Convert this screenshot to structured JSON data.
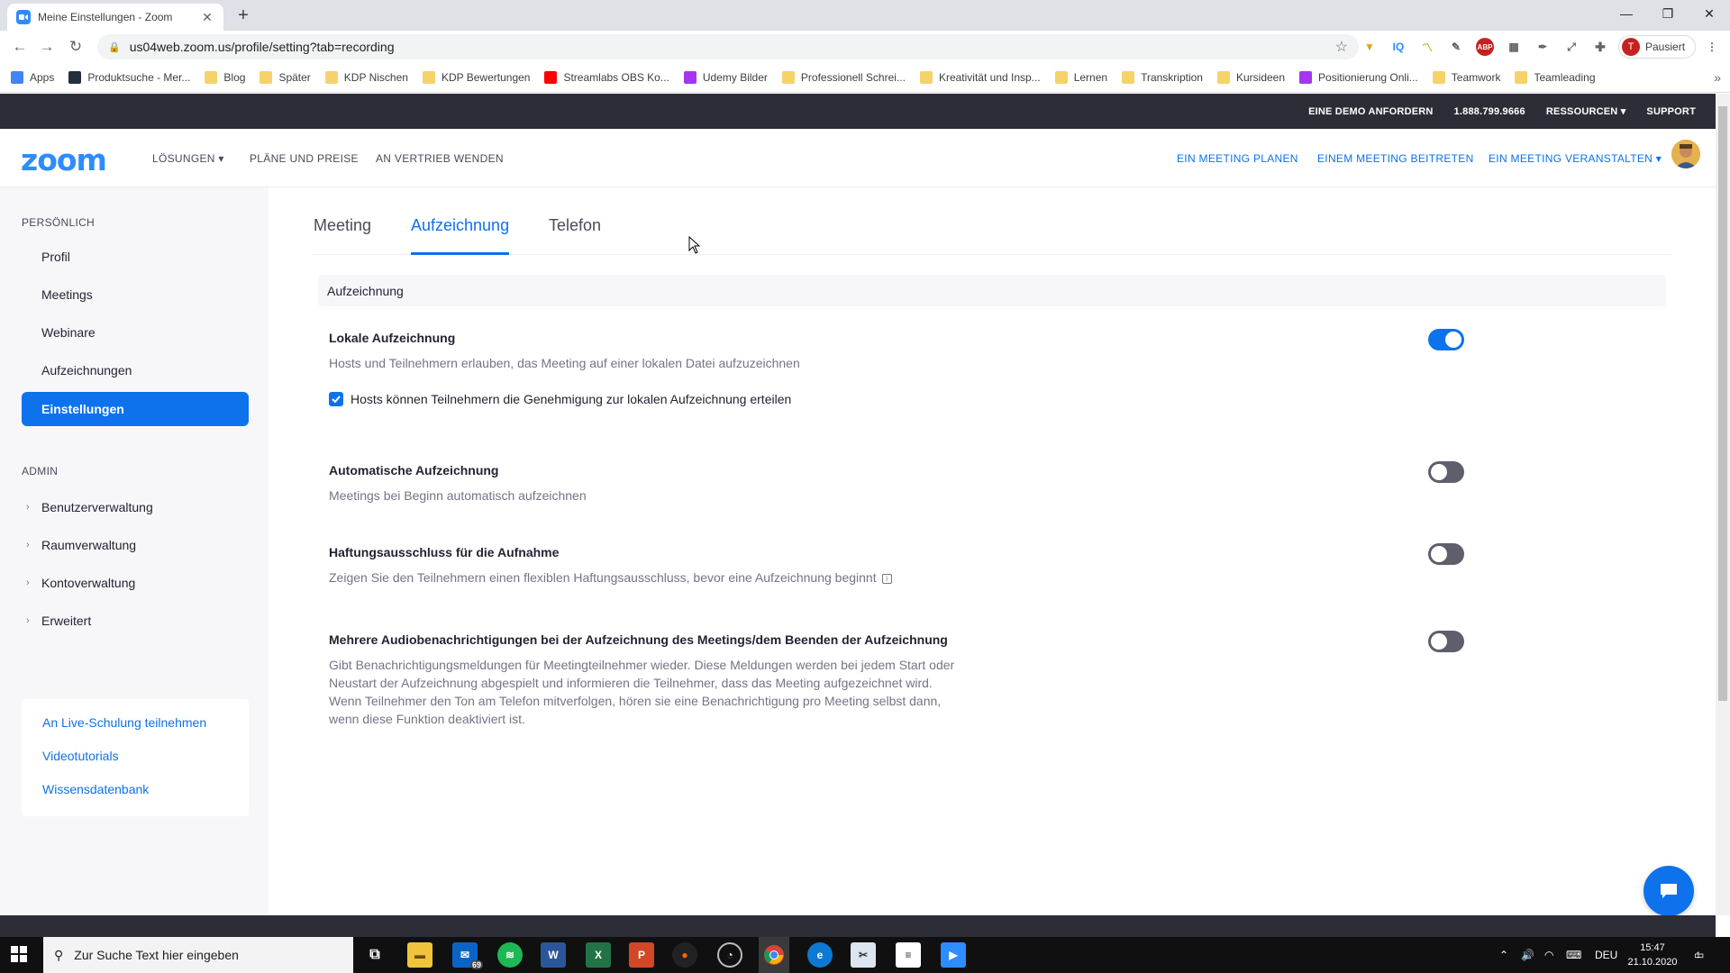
{
  "browser": {
    "tab_title": "Meine Einstellungen - Zoom",
    "new_tab": "+",
    "url": "us04web.zoom.us/profile/setting?tab=recording",
    "profile_initial": "T",
    "profile_status": "Pausiert",
    "ext_iq": "IQ",
    "ext_abp": "ABP"
  },
  "bookmarks": [
    {
      "label": "Apps",
      "icon": "apps-grid-icon"
    },
    {
      "label": "Produktsuche - Mer...",
      "icon": "merch-icon"
    },
    {
      "label": "Blog",
      "icon": "folder-icon"
    },
    {
      "label": "Später",
      "icon": "folder-icon"
    },
    {
      "label": "KDP Nischen",
      "icon": "folder-icon"
    },
    {
      "label": "KDP Bewertungen",
      "icon": "folder-icon"
    },
    {
      "label": "Streamlabs OBS Ko...",
      "icon": "youtube-icon"
    },
    {
      "label": "Udemy Bilder",
      "icon": "udemy-icon"
    },
    {
      "label": "Professionell Schrei...",
      "icon": "folder-icon"
    },
    {
      "label": "Kreativität und Insp...",
      "icon": "folder-icon"
    },
    {
      "label": "Lernen",
      "icon": "folder-icon"
    },
    {
      "label": "Transkription",
      "icon": "folder-icon"
    },
    {
      "label": "Kursideen",
      "icon": "folder-icon"
    },
    {
      "label": "Positionierung Onli...",
      "icon": "udemy-icon"
    },
    {
      "label": "Teamwork",
      "icon": "folder-icon"
    },
    {
      "label": "Teamleading",
      "icon": "folder-icon"
    }
  ],
  "zoom_top": {
    "demo": "EINE DEMO ANFORDERN",
    "phone": "1.888.799.9666",
    "resources": "RESSOURCEN",
    "support": "SUPPORT"
  },
  "zoom_nav": {
    "logo": "zoom",
    "solutions": "LÖSUNGEN",
    "plans": "PLÄNE UND PREISE",
    "sales": "AN VERTRIEB WENDEN",
    "schedule": "EIN MEETING PLANEN",
    "join": "EINEM MEETING BEITRETEN",
    "host": "EIN MEETING VERANSTALTEN"
  },
  "sidebar": {
    "personal_label": "PERSÖNLICH",
    "personal_items": [
      "Profil",
      "Meetings",
      "Webinare",
      "Aufzeichnungen",
      "Einstellungen"
    ],
    "admin_label": "ADMIN",
    "admin_items": [
      "Benutzerverwaltung",
      "Raumverwaltung",
      "Kontoverwaltung",
      "Erweitert"
    ],
    "help_links": [
      "An Live-Schulung teilnehmen",
      "Videotutorials",
      "Wissensdatenbank"
    ]
  },
  "main": {
    "tabs": [
      "Meeting",
      "Aufzeichnung",
      "Telefon"
    ],
    "section_title": "Aufzeichnung",
    "settings": [
      {
        "title": "Lokale Aufzeichnung",
        "desc": "Hosts und Teilnehmern erlauben, das Meeting auf einer lokalen Datei aufzuzeichnen",
        "enabled": true,
        "checkbox_label": "Hosts können Teilnehmern die Genehmigung zur lokalen Aufzeichnung erteilen",
        "checkbox_checked": true
      },
      {
        "title": "Automatische Aufzeichnung",
        "desc": "Meetings bei Beginn automatisch aufzeichnen",
        "enabled": false
      },
      {
        "title": "Haftungsausschluss für die Aufnahme",
        "desc": "Zeigen Sie den Teilnehmern einen flexiblen Haftungsausschluss, bevor eine Aufzeichnung beginnt",
        "enabled": false
      },
      {
        "title": "Mehrere Audiobenachrichtigungen bei der Aufzeichnung des Meetings/dem Beenden der Aufzeichnung",
        "desc": "Gibt Benachrichtigungsmeldungen für Meetingteilnehmer wieder. Diese Meldungen werden bei jedem Start oder Neustart der Aufzeichnung abgespielt und informieren die Teilnehmer, dass das Meeting aufgezeichnet wird. Wenn Teilnehmer den Ton am Telefon mitverfolgen, hören sie eine Benachrichtigung pro Meeting selbst dann, wenn diese Funktion deaktiviert ist.",
        "enabled": false
      }
    ]
  },
  "taskbar": {
    "search_placeholder": "Zur Suche Text hier eingeben",
    "mail_badge": "69",
    "lang": "DEU",
    "time": "15:47",
    "date": "21.10.2020",
    "notif_count": "1"
  },
  "colors": {
    "zoom_blue": "#0e72ed",
    "dark_bar": "#2d2d38",
    "toggle_off": "#5e5e6c"
  }
}
